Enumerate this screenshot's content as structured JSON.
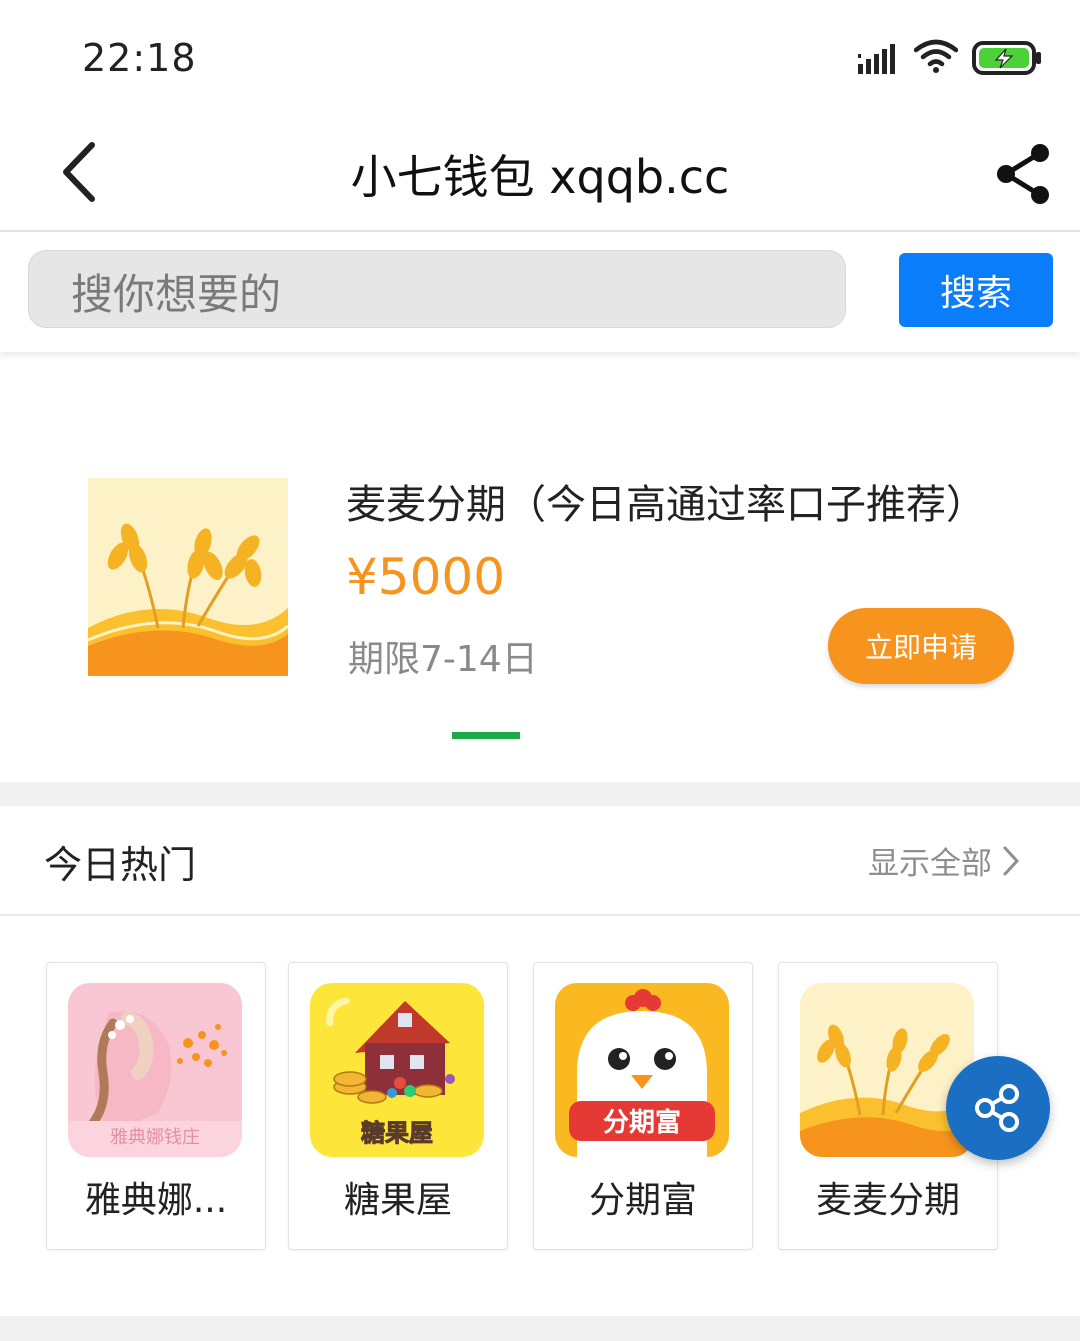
{
  "status_bar": {
    "time": "22:18",
    "icons": [
      "signal-icon",
      "wifi-icon",
      "battery-charging-icon"
    ]
  },
  "nav": {
    "title": "小七钱包 xqqb.cc",
    "back_icon": "chevron-left-icon",
    "share_icon": "share-icon"
  },
  "search": {
    "placeholder": "搜你想要的",
    "button_label": "搜索"
  },
  "banner": {
    "title": "麦麦分期（今日高通过率口子推荐）",
    "amount": "¥5000",
    "term": "期限7-14日",
    "apply_label": "立即申请",
    "image": "wheat-logo"
  },
  "hot": {
    "title": "今日热门",
    "show_all": "显示全部",
    "items": [
      {
        "label": "雅典娜...",
        "icon": "lady-flower-logo",
        "logo_text": "雅典娜钱庄"
      },
      {
        "label": "糖果屋",
        "icon": "candy-house-logo",
        "logo_text": "糖果屋"
      },
      {
        "label": "分期富",
        "icon": "chicken-logo",
        "logo_text": "分期富"
      },
      {
        "label": "麦麦分期",
        "icon": "wheat-logo"
      }
    ]
  },
  "colors": {
    "accent_blue": "#0a7dfa",
    "orange": "#f7941d",
    "indicator_green": "#1ea94a",
    "float_button": "#1a6fc2"
  }
}
